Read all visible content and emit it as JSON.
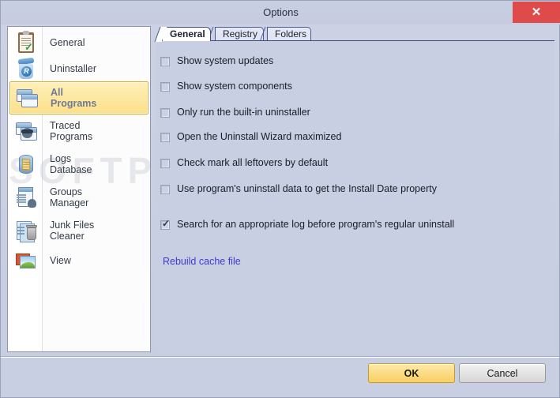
{
  "window": {
    "title": "Options",
    "close_label": "✕",
    "close_icon": "close-icon"
  },
  "sidebar": {
    "items": [
      {
        "label": "General",
        "icon": "clipboard-check-icon",
        "selected": false,
        "two_line": false
      },
      {
        "label": "Uninstaller",
        "icon": "recycle-bin-icon",
        "selected": false,
        "two_line": false
      },
      {
        "label": "All\nPrograms",
        "icon": "windows-stack-icon",
        "selected": true,
        "two_line": true
      },
      {
        "label": "Traced\nPrograms",
        "icon": "spy-window-icon",
        "selected": false,
        "two_line": true
      },
      {
        "label": "Logs\nDatabase",
        "icon": "database-icon",
        "selected": false,
        "two_line": true
      },
      {
        "label": "Groups\nManager",
        "icon": "document-user-icon",
        "selected": false,
        "two_line": true
      },
      {
        "label": "Junk Files\nCleaner",
        "icon": "junk-files-icon",
        "selected": false,
        "two_line": true
      },
      {
        "label": "View",
        "icon": "picture-icon",
        "selected": false,
        "two_line": false
      }
    ]
  },
  "tabs": [
    {
      "label": "General",
      "active": true
    },
    {
      "label": "Registry",
      "active": false
    },
    {
      "label": "Folders",
      "active": false
    }
  ],
  "options": [
    {
      "label": "Show system updates",
      "checked": false
    },
    {
      "label": "Show system components",
      "checked": false
    },
    {
      "label": "Only run the built-in uninstaller",
      "checked": false
    },
    {
      "label": "Open the Uninstall Wizard maximized",
      "checked": false
    },
    {
      "label": "Check mark all leftovers by default",
      "checked": false
    },
    {
      "label": "Use program's uninstall data to get the Install Date property",
      "checked": false
    },
    {
      "label": "Search for an appropriate log before program's regular uninstall",
      "checked": true
    }
  ],
  "link": {
    "label": "Rebuild cache file"
  },
  "footer": {
    "ok_label": "OK",
    "cancel_label": "Cancel"
  },
  "watermark": {
    "text": "SOFTPEDIA"
  },
  "colors": {
    "window_background": "#c9cfe2",
    "titlebar": "#c9cfe3",
    "close_button": "#df4b4b",
    "accent_tab_line": "#3c4d8c",
    "selected_item": "#fde08a",
    "ok_button": "#f9cf62",
    "link": "#3b3bd0"
  }
}
